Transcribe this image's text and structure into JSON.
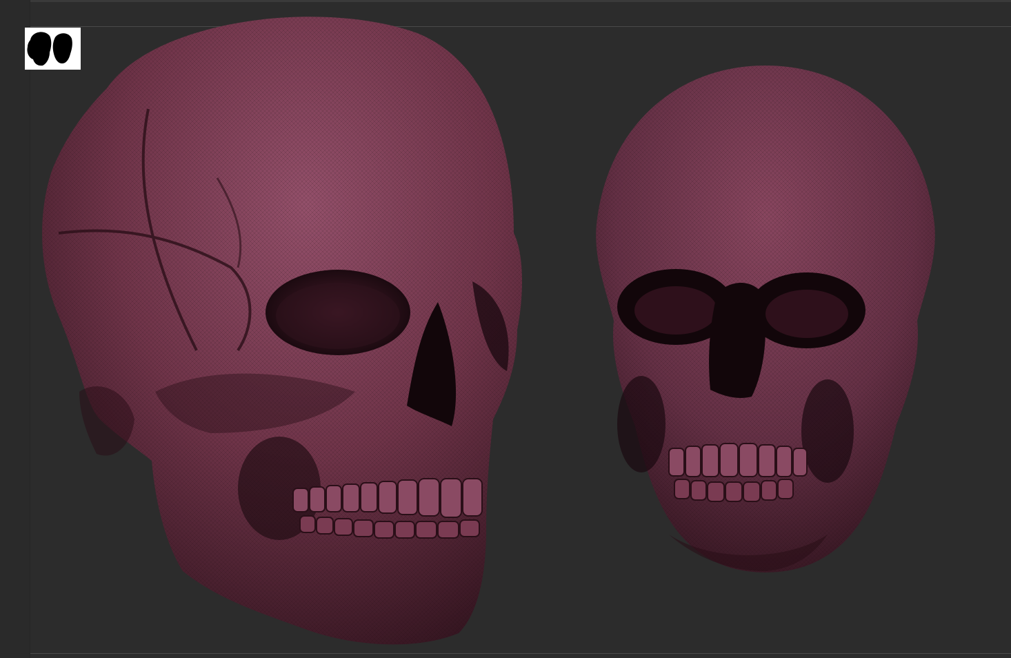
{
  "viewport": {
    "background_color": "#2c2c2c",
    "frame_line_color": "#4a4a4a"
  },
  "navigator": {
    "icon": "two-skulls-silhouette-icon",
    "background_color": "#ffffff",
    "silhouette_color": "#000000"
  },
  "models": [
    {
      "name": "skull-three-quarter-view",
      "material_color": "#7a3b52",
      "shadow_color": "#2a1119"
    },
    {
      "name": "skull-front-view",
      "material_color": "#6f3449",
      "shadow_color": "#250f17"
    }
  ]
}
